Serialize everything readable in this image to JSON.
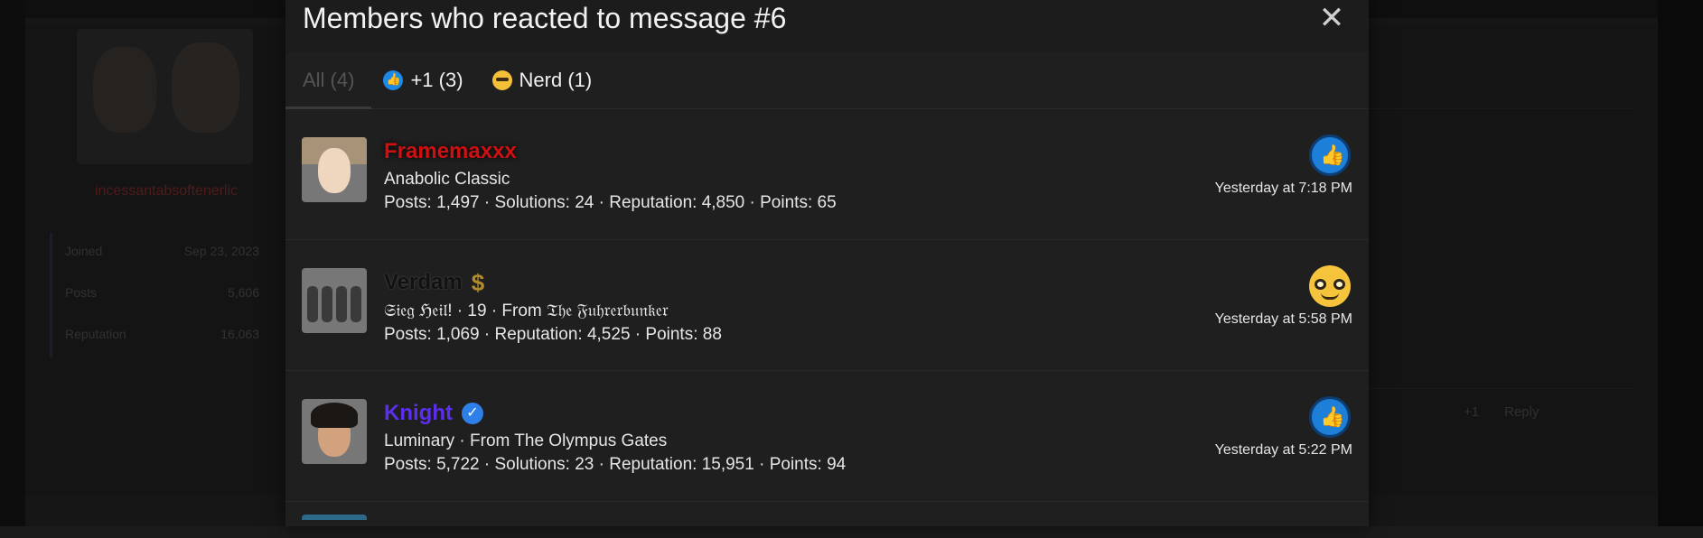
{
  "modal": {
    "title": "Members who reacted to message #6",
    "close_icon": "close-icon"
  },
  "tabs": [
    {
      "label": "All (4)",
      "icon": null
    },
    {
      "label": "+1 (3)",
      "icon": "thumbs-up-icon"
    },
    {
      "label": "Nerd (1)",
      "icon": "nerd-face-icon"
    }
  ],
  "members": [
    {
      "username": "Framemaxxx",
      "username_color": "#d01010",
      "title": "Anabolic Classic",
      "stats": "Posts: 1,497 · Solutions: 24 · Reputation: 4,850 · Points: 65",
      "reaction": "thumbs-up-icon",
      "time": "Yesterday at 7:18 PM"
    },
    {
      "username": "Verdam",
      "username_color": "#111111",
      "badge": "dollar-sign-icon",
      "title": "𝔖𝔦𝔢𝔤 ℌ𝔢𝔦𝔩! · 19 · From 𝔗𝔥𝔢 𝔉𝔲𝔥𝔯𝔢𝔯𝔟𝔲𝔫𝔨𝔢𝔯",
      "stats": "Posts: 1,069 · Reputation: 4,525 · Points: 88",
      "reaction": "nerd-face-icon",
      "time": "Yesterday at 5:58 PM"
    },
    {
      "username": "Knight",
      "username_color": "#5b2ef0",
      "badge": "verified-check-icon",
      "title": "Luminary · From The Olympus Gates",
      "stats": "Posts: 5,722 · Solutions: 23 · Reputation: 15,951 · Points: 94",
      "reaction": "thumbs-up-icon",
      "time": "Yesterday at 5:22 PM"
    }
  ],
  "background": {
    "poster_username": "incessantabsoftenerlic",
    "sidebar_stats": [
      {
        "label": "Joined",
        "value": "Sep 23, 2023"
      },
      {
        "label": "Posts",
        "value": "5,606"
      },
      {
        "label": "Reputation",
        "value": "16,063"
      }
    ],
    "reaction_summary": "+1",
    "reply_label": "Reply"
  },
  "colors": {
    "like_blue": "#1e7fd8",
    "nerd_yellow": "#f6c43c",
    "modal_bg": "#1f1f20"
  }
}
